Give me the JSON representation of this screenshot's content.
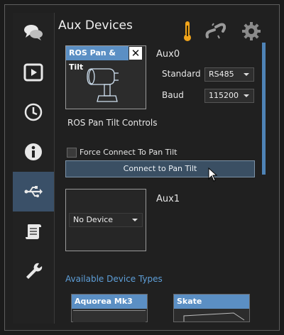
{
  "header": {
    "title": "Aux Devices"
  },
  "top_icons": [
    "thermometer-icon",
    "link-icon",
    "gear-icon"
  ],
  "sidebar": {
    "items": [
      {
        "name": "chat",
        "icon": "chat-bubbles-icon",
        "active": false
      },
      {
        "name": "media",
        "icon": "play-icon",
        "active": false
      },
      {
        "name": "history",
        "icon": "clock-icon",
        "active": false
      },
      {
        "name": "info",
        "icon": "info-icon",
        "active": false
      },
      {
        "name": "usb",
        "icon": "usb-icon",
        "active": true
      },
      {
        "name": "scripts",
        "icon": "scroll-icon",
        "active": false
      },
      {
        "name": "tools",
        "icon": "wrench-icon",
        "active": false
      }
    ]
  },
  "aux0": {
    "label": "Aux0",
    "device_card_title": "ROS Pan & Tilt",
    "close_label": "✕",
    "standard_label": "Standard",
    "standard_value": "RS485",
    "baud_label": "Baud",
    "baud_value": "115200",
    "controls_title": "ROS Pan Tilt Controls",
    "force_connect_label": "Force Connect To Pan Tilt",
    "force_connect_checked": false,
    "connect_button_label": "Connect to Pan Tilt"
  },
  "aux1": {
    "label": "Aux1",
    "device_value": "No Device"
  },
  "available": {
    "title": "Available Device Types",
    "devices": [
      "Aquorea Mk3",
      "Skate"
    ]
  },
  "colors": {
    "accent": "#5b8fc4",
    "active_nav": "#3a5068",
    "background": "#202020"
  }
}
